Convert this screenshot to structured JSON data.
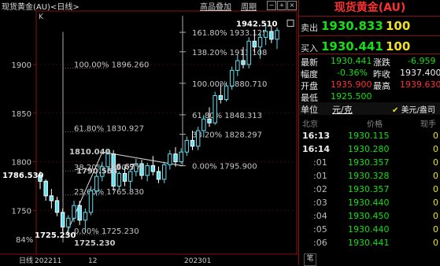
{
  "chart_header": {
    "title": "现货黄金(AU)<日线>",
    "link_overlay": "高品叠加",
    "link_period": "周期",
    "btn_minus": "−",
    "btn_plus": "+",
    "btn_close": "×"
  },
  "chart_corner_label": "K",
  "x_axis": {
    "period_label": "日线",
    "labels": [
      "202211",
      "12",
      "202301"
    ]
  },
  "chart_data": {
    "type": "candlestick",
    "title": "现货黄金(AU)<日线>",
    "ylim": [
      1705,
      1955
    ],
    "y_ticks": [
      1750,
      1800,
      1850,
      1900
    ],
    "y_tick_labels": [
      "1750",
      "1800",
      "1850",
      "1900"
    ],
    "candles": [
      [
        1786.5,
        1790,
        1772,
        1780
      ],
      [
        1780,
        1782,
        1760,
        1765
      ],
      [
        1765,
        1772,
        1752,
        1760
      ],
      [
        1760,
        1764,
        1744,
        1748
      ],
      [
        1748,
        1752,
        1728,
        1733
      ],
      [
        1733,
        1745,
        1725,
        1742
      ],
      [
        1742,
        1760,
        1738,
        1755
      ],
      [
        1755,
        1760,
        1735,
        1740
      ],
      [
        1740,
        1752,
        1728,
        1748
      ],
      [
        1748,
        1775,
        1745,
        1770
      ],
      [
        1770,
        1790,
        1765,
        1785
      ],
      [
        1785,
        1800,
        1780,
        1795
      ],
      [
        1795,
        1812,
        1788,
        1808
      ],
      [
        1808,
        1812,
        1770,
        1775
      ],
      [
        1775,
        1790,
        1772,
        1788
      ],
      [
        1788,
        1795,
        1775,
        1780
      ],
      [
        1780,
        1792,
        1772,
        1790
      ],
      [
        1790,
        1803,
        1785,
        1798
      ],
      [
        1798,
        1802,
        1782,
        1786
      ],
      [
        1786,
        1799,
        1780,
        1796
      ],
      [
        1796,
        1806,
        1786,
        1790
      ],
      [
        1790,
        1795,
        1778,
        1782
      ],
      [
        1782,
        1800,
        1778,
        1797
      ],
      [
        1797,
        1812,
        1792,
        1808
      ],
      [
        1808,
        1815,
        1795,
        1800
      ],
      [
        1800,
        1814,
        1798,
        1810
      ],
      [
        1810,
        1826,
        1806,
        1822
      ],
      [
        1822,
        1832,
        1812,
        1816
      ],
      [
        1816,
        1836,
        1812,
        1832
      ],
      [
        1832,
        1848,
        1826,
        1844
      ],
      [
        1844,
        1856,
        1836,
        1840
      ],
      [
        1840,
        1872,
        1838,
        1868
      ],
      [
        1868,
        1880,
        1860,
        1864
      ],
      [
        1864,
        1882,
        1862,
        1878
      ],
      [
        1878,
        1898,
        1874,
        1894
      ],
      [
        1894,
        1910,
        1888,
        1904
      ],
      [
        1904,
        1918,
        1896,
        1900
      ],
      [
        1900,
        1928,
        1896,
        1924
      ],
      [
        1924,
        1936,
        1912,
        1918
      ],
      [
        1918,
        1932,
        1906,
        1928
      ],
      [
        1928,
        1942.5,
        1920,
        1934
      ],
      [
        1934,
        1940,
        1922,
        1926
      ],
      [
        1926,
        1938,
        1916,
        1935
      ]
    ],
    "annotations": [
      {
        "text": "1942.510",
        "x": 340,
        "y": 1942.51,
        "color": "#ffffff"
      },
      {
        "text": "1786.530",
        "x": 43,
        "y": 1786.53,
        "color": "#ffffff"
      },
      {
        "text": "1725.230",
        "x": 84,
        "y": 1725.23,
        "color": "#ffffff"
      },
      {
        "text": "1725.230",
        "x": 134,
        "y": 1717.0,
        "color": "#c8c8c8"
      },
      {
        "text": "1810.040",
        "x": 128,
        "y": 1811.0,
        "color": "#c8c8c8"
      },
      {
        "text": "1790.563",
        "x": 137,
        "y": 1791.0,
        "color": "#c8c8c8"
      },
      {
        "text": "16.67%",
        "x": 180,
        "y": 1795.5,
        "color": "#c8c8c8"
      }
    ],
    "fib_left": [
      {
        "pct": "100.00%",
        "value": "1896.260",
        "y": 1896.26
      },
      {
        "pct": "61.80%",
        "value": "1830.927",
        "y": 1830.927
      },
      {
        "pct": "38.20%",
        "value": "1790.563",
        "y": 1790.563
      },
      {
        "pct": "23.60%",
        "value": "1765.830",
        "y": 1765.83
      },
      {
        "pct": "0.00%",
        "value": "1725.230",
        "y": 1725.23
      }
    ],
    "fib_right": [
      {
        "pct": "161.80%",
        "value": "1933.125",
        "y": 1933.125
      },
      {
        "pct": "138.20%",
        "value": "1913.108",
        "y": 1913.108
      },
      {
        "pct": "100.00%",
        "value": "1880.710",
        "y": 1880.71
      },
      {
        "pct": "61.80%",
        "value": "1848.313",
        "y": 1848.313
      },
      {
        "pct": "38.20%",
        "value": "1828.297",
        "y": 1828.297
      },
      {
        "pct": "0.00%",
        "value": "1795.900",
        "y": 1795.9
      }
    ],
    "left_edge_pct": "84%"
  },
  "panel": {
    "title": "现货黄金(AU)",
    "sell_label": "卖出",
    "sell_price": "1930.833",
    "sell_qty": "100",
    "buy_label": "买入",
    "buy_price": "1930.441",
    "buy_qty": "100",
    "stats": [
      {
        "l1": "最新",
        "v1": "1930.441",
        "l2": "涨跌",
        "v2": "-6.959"
      },
      {
        "l1": "幅度",
        "v1": "-0.36%",
        "l2": "昨收",
        "v2": "1937.400"
      },
      {
        "l1": "开盘",
        "v1": "1935.900",
        "l2": "最高",
        "v2": "1939.630"
      },
      {
        "l1": "最低",
        "v1": "1925.500",
        "l2": "",
        "v2": ""
      }
    ],
    "unit_label": "单位",
    "unit_value": "元/克",
    "currency_value": "美元/盎司",
    "tick_head": {
      "time": "北京",
      "price": "价格",
      "qty": "现手"
    },
    "ticks": [
      {
        "time": "16:13",
        "price": "1930.115",
        "qty": "0"
      },
      {
        "time": "16:14",
        "price": "1930.280",
        "qty": "0"
      },
      {
        "time": ":01",
        "price": "1930.357",
        "qty": "0"
      },
      {
        "time": ":01",
        "price": "1930.328",
        "qty": "0"
      },
      {
        "time": ":02",
        "price": "1930.357",
        "qty": "0"
      },
      {
        "time": ":03",
        "price": "1930.440",
        "qty": "0"
      },
      {
        "time": ":04",
        "price": "1930.450",
        "qty": "0"
      },
      {
        "time": ":05",
        "price": "1930.440",
        "qty": "0"
      },
      {
        "time": ":06",
        "price": "1930.441",
        "qty": "0"
      }
    ],
    "bottom_tab": "笔"
  }
}
